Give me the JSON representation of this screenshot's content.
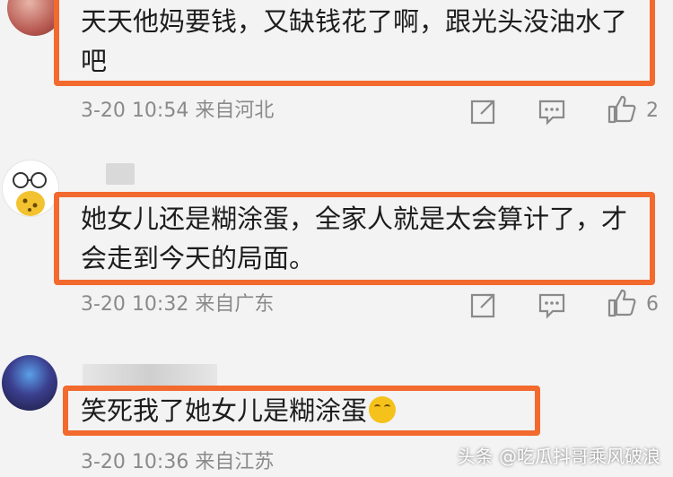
{
  "comments": [
    {
      "text": [
        "天天他妈要钱，又缺钱花了啊，跟光头没油水了",
        "吧"
      ],
      "date": "3-20",
      "time": "10:54",
      "location": "来自河北",
      "likes": "2"
    },
    {
      "text": [
        "她女儿还是糊涂蛋，全家人就是太会算计了，才",
        "会走到今天的局面。"
      ],
      "date": "3-20",
      "time": "10:32",
      "location": "来自广东",
      "likes": "6"
    },
    {
      "text": [
        "笑死我了她女儿是糊涂蛋"
      ],
      "date": "3-20",
      "time": "10:36",
      "location": "来自江苏",
      "likes": ""
    }
  ],
  "watermark": "头条 @吃瓜抖哥乘风破浪",
  "icons": [
    "share-icon",
    "comment-icon",
    "like-icon"
  ],
  "colors": {
    "highlight": "#f26a2e",
    "meta": "#8a8a8a",
    "text": "#1c1c1c"
  }
}
